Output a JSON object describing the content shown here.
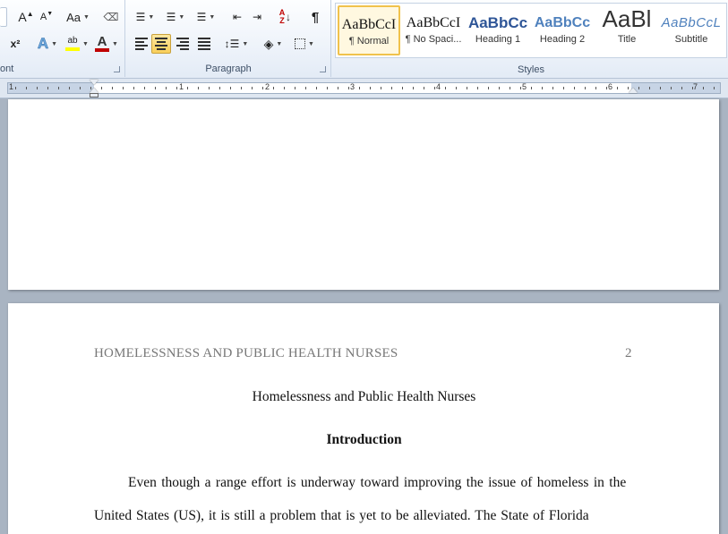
{
  "ribbon": {
    "font_group": {
      "label": "ont",
      "grow_font": "A",
      "shrink_font": "A",
      "change_case": "Aa",
      "superscript": "x²",
      "text_effects": "A",
      "highlight": "ab",
      "font_color": "A"
    },
    "paragraph_group": {
      "label": "Paragraph",
      "sort": "↓",
      "sort_az": "A Z",
      "pilcrow": "¶"
    },
    "styles_group": {
      "label": "Styles",
      "items": [
        {
          "preview": "AaBbCcI",
          "name": "¶ Normal"
        },
        {
          "preview": "AaBbCcI",
          "name": "¶ No Spaci..."
        },
        {
          "preview": "AaBbCc",
          "name": "Heading 1"
        },
        {
          "preview": "AaBbCc",
          "name": "Heading 2"
        },
        {
          "preview": "AaBl",
          "name": "Title"
        },
        {
          "preview": "AaBbCcL",
          "name": "Subtitle"
        }
      ]
    }
  },
  "ruler": {
    "numbers": [
      "1",
      "1",
      "2",
      "3",
      "4",
      "5",
      "6",
      "7"
    ]
  },
  "document": {
    "running_head": "HOMELESSNESS AND PUBLIC HEALTH NURSES",
    "page_number": "2",
    "title": "Homelessness and Public Health Nurses",
    "heading": "Introduction",
    "paragraph_lines": [
      "Even though a range effort is underway toward improving the issue of homeless in the",
      "United States (US), it is still a problem that is yet to be alleviated. The State of Florida"
    ]
  },
  "colors": {
    "ribbon_bg": "#eef3fa",
    "active_button": "#f9cf5a",
    "workspace_bg": "#a9b4c2",
    "heading1_blue": "#2e5597",
    "font_color_red": "#c00000",
    "highlight_yellow": "#ffff00",
    "header_gray": "#777777"
  }
}
